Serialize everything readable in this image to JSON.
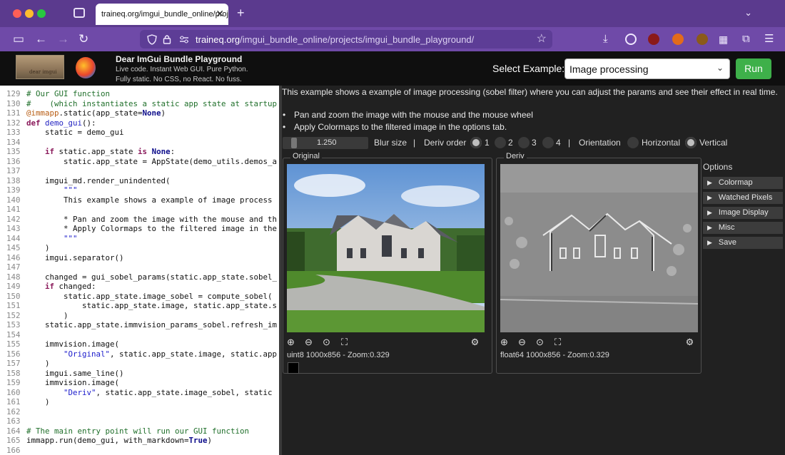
{
  "browser": {
    "tab_title": "traineq.org/imgui_bundle_online/projects/imgui_bundle_playground/",
    "tab_close": "✕",
    "new_tab": "+",
    "tabs_menu": "⌄",
    "url_host": "traineq.org",
    "url_path": "/imgui_bundle_online/projects/imgui_bundle_playground/",
    "nav": {
      "sidebar": "▭",
      "back": "←",
      "forward": "→",
      "reload": "↻"
    },
    "icons": [
      "shield-icon",
      "lock-icon",
      "permissions-icon",
      "bookmark-star-icon",
      "download-icon",
      "account-icon",
      "ublock-icon",
      "extension-icon",
      "menu-icon"
    ]
  },
  "header": {
    "logo_text": "dear imgui",
    "title": "Dear ImGui Bundle Playground",
    "subtitle_1": "Live code. Instant Web GUI. Pure Python.",
    "subtitle_2": "Fully static. No CSS, no React. No fuss.",
    "select_label": "Select Example:",
    "select_value": "Image processing",
    "run_label": "Run"
  },
  "editor": {
    "lines": [
      {
        "n": "129",
        "code": "# Our GUI function"
      },
      {
        "n": "130",
        "code": "#    (which instantiates a static app state at startup"
      },
      {
        "n": "131",
        "code": "@immapp.static(app_state=None)"
      },
      {
        "n": "132",
        "code": "def demo_gui():"
      },
      {
        "n": "133",
        "code": "    static = demo_gui"
      },
      {
        "n": "134",
        "code": ""
      },
      {
        "n": "135",
        "code": "    if static.app_state is None:"
      },
      {
        "n": "136",
        "code": "        static.app_state = AppState(demo_utils.demos_a"
      },
      {
        "n": "137",
        "code": ""
      },
      {
        "n": "138",
        "code": "    imgui_md.render_unindented("
      },
      {
        "n": "139",
        "code": "        \"\"\""
      },
      {
        "n": "140",
        "code": "        This example shows a example of image process"
      },
      {
        "n": "141",
        "code": ""
      },
      {
        "n": "142",
        "code": "        * Pan and zoom the image with the mouse and th"
      },
      {
        "n": "143",
        "code": "        * Apply Colormaps to the filtered image in the"
      },
      {
        "n": "144",
        "code": "        \"\"\""
      },
      {
        "n": "145",
        "code": "    )"
      },
      {
        "n": "146",
        "code": "    imgui.separator()"
      },
      {
        "n": "147",
        "code": ""
      },
      {
        "n": "148",
        "code": "    changed = gui_sobel_params(static.app_state.sobel_"
      },
      {
        "n": "149",
        "code": "    if changed:"
      },
      {
        "n": "150",
        "code": "        static.app_state.image_sobel = compute_sobel("
      },
      {
        "n": "151",
        "code": "            static.app_state.image, static.app_state.s"
      },
      {
        "n": "152",
        "code": "        )"
      },
      {
        "n": "153",
        "code": "    static.app_state.immvision_params_sobel.refresh_im"
      },
      {
        "n": "154",
        "code": ""
      },
      {
        "n": "155",
        "code": "    immvision.image("
      },
      {
        "n": "156",
        "code": "        \"Original\", static.app_state.image, static.app"
      },
      {
        "n": "157",
        "code": "    )"
      },
      {
        "n": "158",
        "code": "    imgui.same_line()"
      },
      {
        "n": "159",
        "code": "    immvision.image("
      },
      {
        "n": "160",
        "code": "        \"Deriv\", static.app_state.image_sobel, static"
      },
      {
        "n": "161",
        "code": "    )"
      },
      {
        "n": "162",
        "code": ""
      },
      {
        "n": "163",
        "code": ""
      },
      {
        "n": "164",
        "code": "# The main entry point will run our GUI function"
      },
      {
        "n": "165",
        "code": "immapp.run(demo_gui, with_markdown=True)"
      },
      {
        "n": "166",
        "code": ""
      }
    ]
  },
  "panel": {
    "description": "This example shows a example of image processing (sobel filter) where you can adjust the params and see their effect in real time.",
    "bullet_1": "Pan and zoom the image with the mouse and the mouse wheel",
    "bullet_2": "Apply Colormaps to the filtered image in the options tab.",
    "blur_value": "1.250",
    "blur_label": "Blur size",
    "separator": "|",
    "deriv_label": "Deriv order",
    "deriv_options": [
      "1",
      "2",
      "3",
      "4"
    ],
    "deriv_selected": "1",
    "orientation_label": "Orientation",
    "orientation_options": [
      "Horizontal",
      "Vertical"
    ],
    "orientation_selected": "Vertical",
    "original": {
      "title": "Original",
      "info": "uint8 1000x856 - Zoom:0.329"
    },
    "deriv": {
      "title": "Deriv",
      "info": "float64 1000x856 - Zoom:0.329"
    },
    "options_title": "Options",
    "options": [
      "Colormap",
      "Watched Pixels",
      "Image Display",
      "Misc",
      "Save"
    ],
    "colors": {
      "run": "#3eb04a",
      "tabbar": "#5b3a8e",
      "navbar": "#6f4aa8",
      "panel_bg": "#212121"
    }
  }
}
